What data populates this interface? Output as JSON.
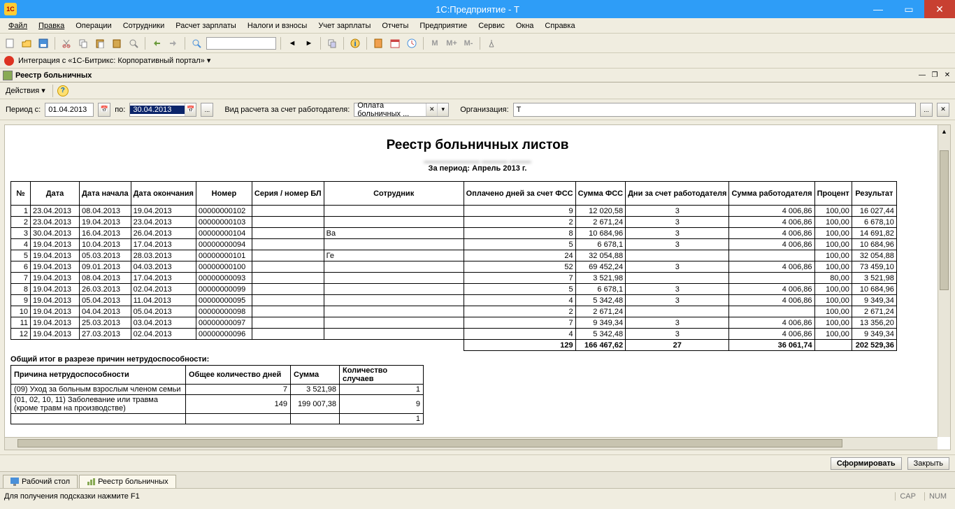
{
  "title": "1С:Предприятие - Т",
  "menu": [
    "Файл",
    "Правка",
    "Операции",
    "Сотрудники",
    "Расчет зарплаты",
    "Налоги и взносы",
    "Учет зарплаты",
    "Отчеты",
    "Предприятие",
    "Сервис",
    "Окна",
    "Справка"
  ],
  "bitrix": "Интеграция с «1С-Битрикс: Корпоративный портал» ▾",
  "tab_title": "Реестр больничных",
  "actions": "Действия ▾",
  "filters": {
    "period_from_label": "Период с:",
    "period_from": "01.04.2013",
    "period_to_label": "по:",
    "period_to": "30.04.2013",
    "calculation_type_label": "Вид расчета за счет работодателя:",
    "calculation_type": "Оплата больничных ...",
    "organization_label": "Организация:",
    "organization": "Т"
  },
  "report": {
    "title": "Реестр больничных листов",
    "period": "За период: Апрель 2013 г.",
    "columns": [
      "№",
      "Дата",
      "Дата начала",
      "Дата окончания",
      "Номер",
      "Серия / номер БЛ",
      "Сотрудник",
      "Оплачено дней за счет ФСС",
      "Сумма ФСС",
      "Дни за счет работодателя",
      "Сумма работодателя",
      "Процент",
      "Результат"
    ],
    "rows": [
      [
        "1",
        "23.04.2013",
        "08.04.2013",
        "19.04.2013",
        "00000000102",
        "",
        "",
        "9",
        "12 020,58",
        "3",
        "4 006,86",
        "100,00",
        "16 027,44"
      ],
      [
        "2",
        "23.04.2013",
        "19.04.2013",
        "23.04.2013",
        "00000000103",
        "",
        "",
        "2",
        "2 671,24",
        "3",
        "4 006,86",
        "100,00",
        "6 678,10"
      ],
      [
        "3",
        "30.04.2013",
        "16.04.2013",
        "26.04.2013",
        "00000000104",
        "",
        "Ва",
        "8",
        "10 684,96",
        "3",
        "4 006,86",
        "100,00",
        "14 691,82"
      ],
      [
        "4",
        "19.04.2013",
        "10.04.2013",
        "17.04.2013",
        "00000000094",
        "",
        "",
        "5",
        "6 678,1",
        "3",
        "4 006,86",
        "100,00",
        "10 684,96"
      ],
      [
        "5",
        "19.04.2013",
        "05.03.2013",
        "28.03.2013",
        "00000000101",
        "",
        "Ге",
        "24",
        "32 054,88",
        "",
        "",
        "100,00",
        "32 054,88"
      ],
      [
        "6",
        "19.04.2013",
        "09.01.2013",
        "04.03.2013",
        "00000000100",
        "",
        "",
        "52",
        "69 452,24",
        "3",
        "4 006,86",
        "100,00",
        "73 459,10"
      ],
      [
        "7",
        "19.04.2013",
        "08.04.2013",
        "17.04.2013",
        "00000000093",
        "",
        "",
        "7",
        "3 521,98",
        "",
        "",
        "80,00",
        "3 521,98"
      ],
      [
        "8",
        "19.04.2013",
        "26.03.2013",
        "02.04.2013",
        "00000000099",
        "",
        "",
        "5",
        "6 678,1",
        "3",
        "4 006,86",
        "100,00",
        "10 684,96"
      ],
      [
        "9",
        "19.04.2013",
        "05.04.2013",
        "11.04.2013",
        "00000000095",
        "",
        "",
        "4",
        "5 342,48",
        "3",
        "4 006,86",
        "100,00",
        "9 349,34"
      ],
      [
        "10",
        "19.04.2013",
        "04.04.2013",
        "05.04.2013",
        "00000000098",
        "",
        "",
        "2",
        "2 671,24",
        "",
        "",
        "100,00",
        "2 671,24"
      ],
      [
        "11",
        "19.04.2013",
        "25.03.2013",
        "03.04.2013",
        "00000000097",
        "",
        "",
        "7",
        "9 349,34",
        "3",
        "4 006,86",
        "100,00",
        "13 356,20"
      ],
      [
        "12",
        "19.04.2013",
        "27.03.2013",
        "02.04.2013",
        "00000000096",
        "",
        "",
        "4",
        "5 342,48",
        "3",
        "4 006,86",
        "100,00",
        "9 349,34"
      ]
    ],
    "totals": [
      "",
      "",
      "",
      "",
      "",
      "",
      "",
      "129",
      "166 467,62",
      "27",
      "36 061,74",
      "",
      "202 529,36"
    ],
    "summary_title": "Общий итог в разрезе причин нетрудоспособности:",
    "summary_cols": [
      "Причина нетрудоспособности",
      "Общее количество дней",
      "Сумма",
      "Количество случаев"
    ],
    "summary_rows": [
      [
        "(09) Уход за больным взрослым членом семьи",
        "7",
        "3 521,98",
        "1"
      ],
      [
        "(01, 02, 10, 11) Заболевание или травма (кроме травм на производстве)",
        "149",
        "199 007,38",
        "9"
      ],
      [
        "",
        "",
        "",
        "1"
      ]
    ]
  },
  "btn_form": "Сформировать",
  "btn_close": "Закрыть",
  "bottom_tabs": [
    "Рабочий стол",
    "Реестр больничных"
  ],
  "status_text": "Для получения подсказки нажмите F1",
  "status_ind": [
    "CAP",
    "NUM"
  ]
}
